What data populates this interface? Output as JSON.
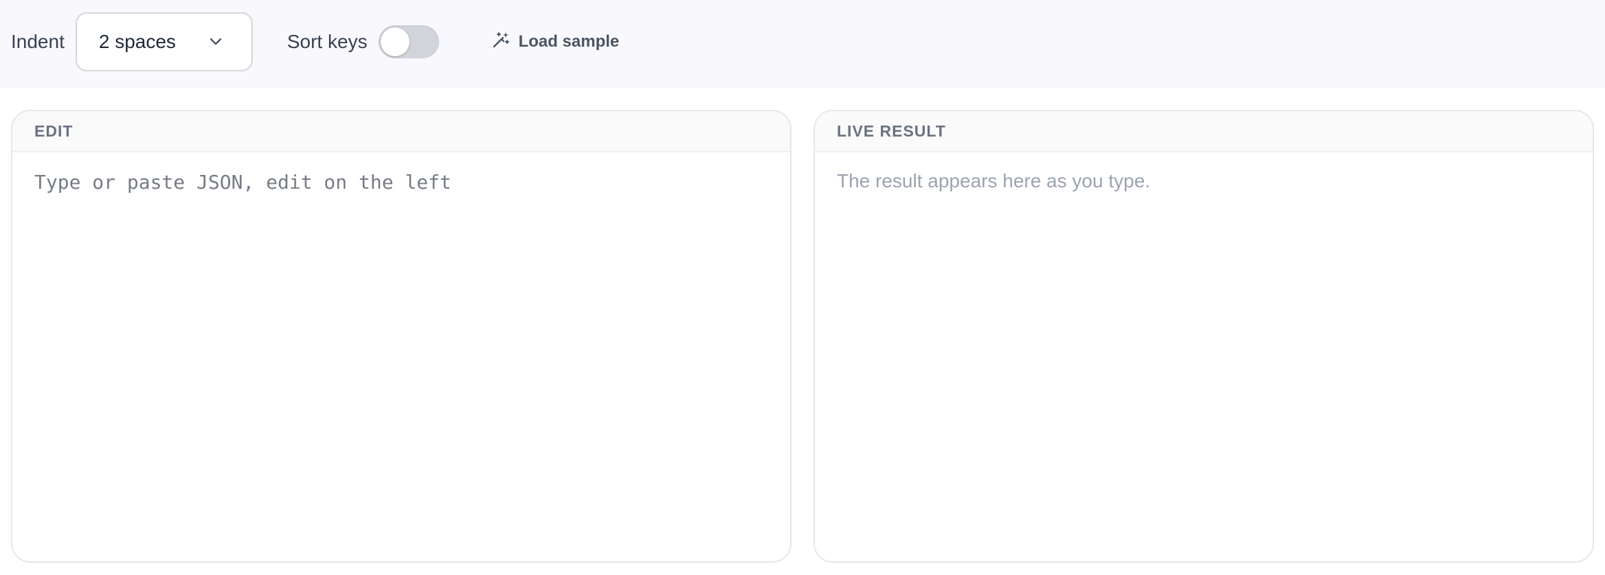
{
  "toolbar": {
    "indent_label": "Indent",
    "indent_value": "2 spaces",
    "sort_keys_label": "Sort keys",
    "sort_keys_on": false,
    "load_sample_label": "Load sample"
  },
  "edit_panel": {
    "title": "EDIT",
    "value": "",
    "placeholder": "Type or paste JSON, edit on the left"
  },
  "result_panel": {
    "title": "LIVE RESULT",
    "empty_message": "The result appears here as you type."
  },
  "icons": {
    "select": "chevron-down-icon",
    "load_sample": "magic-wand-icon"
  },
  "colors": {
    "toolbar_bg": "#f8f8fd",
    "toggle_off": "#d1d5db",
    "border": "#e5e7eb",
    "muted_text": "#9ca3af"
  }
}
